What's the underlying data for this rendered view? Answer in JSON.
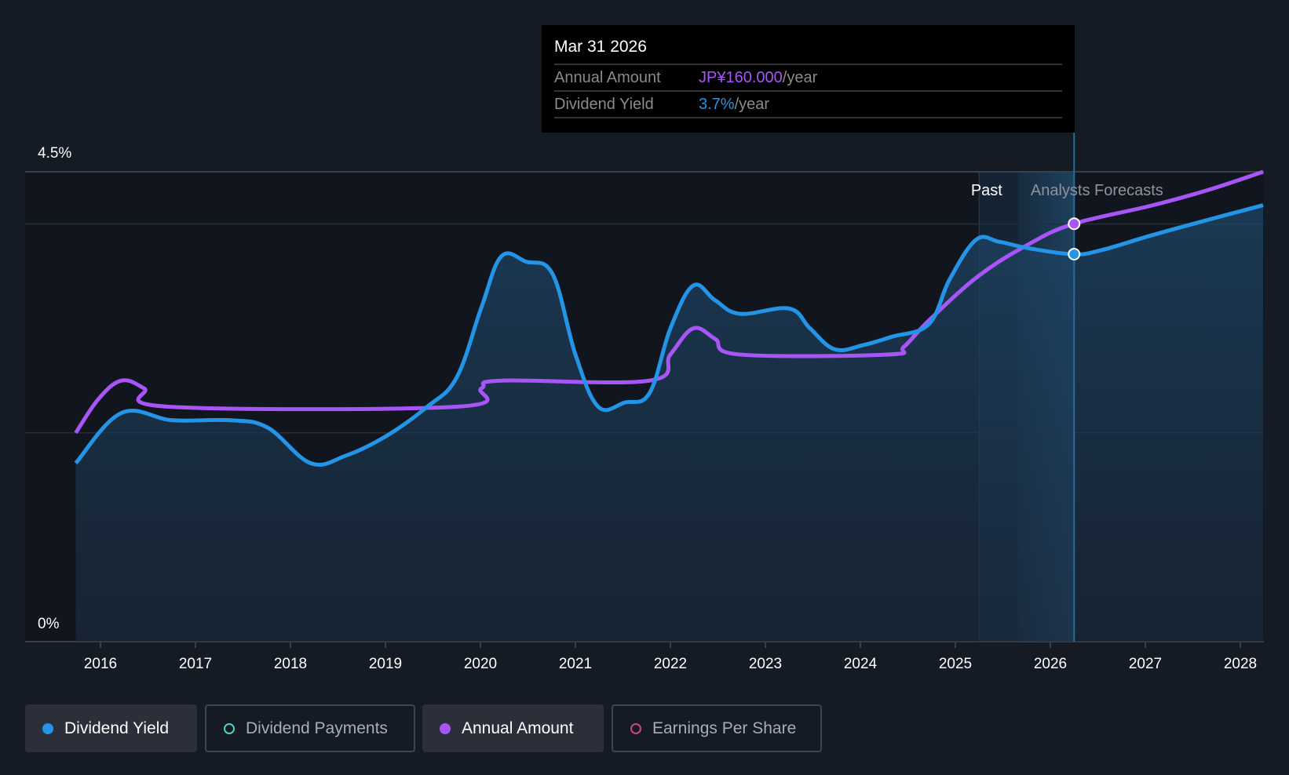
{
  "tooltip": {
    "date": "Mar 31 2026",
    "rows": [
      {
        "label": "Annual Amount",
        "value": "JP¥160.000",
        "unit": "/year",
        "color": "#a855f7"
      },
      {
        "label": "Dividend Yield",
        "value": "3.7%",
        "unit": "/year",
        "color": "#2394e6"
      }
    ]
  },
  "legend": [
    {
      "label": "Dividend Yield",
      "color": "#2394e6",
      "active": true
    },
    {
      "label": "Dividend Payments",
      "color": "#4fd1c5",
      "active": false
    },
    {
      "label": "Annual Amount",
      "color": "#a855f7",
      "active": true
    },
    {
      "label": "Earnings Per Share",
      "color": "#d0457f",
      "active": false
    }
  ],
  "chart_data": {
    "type": "line",
    "y_labels": [
      "4.5%",
      "0%"
    ],
    "ylim": [
      0,
      4.5
    ],
    "xlim": [
      2015.74,
      2028.24
    ],
    "x_ticks": [
      "2016",
      "2017",
      "2018",
      "2019",
      "2020",
      "2021",
      "2022",
      "2023",
      "2024",
      "2025",
      "2026",
      "2027",
      "2028"
    ],
    "region_labels": {
      "past": "Past",
      "forecast": "Analysts Forecasts"
    },
    "past_end": 2025.25,
    "forecast_start": 2025.66,
    "hover_x": 2026.25,
    "series": [
      {
        "name": "Dividend Yield",
        "unit": "%",
        "color": "#2394e6",
        "points": [
          [
            2015.74,
            1.71
          ],
          [
            2016.22,
            2.19
          ],
          [
            2016.76,
            2.12
          ],
          [
            2017.37,
            2.12
          ],
          [
            2017.76,
            2.05
          ],
          [
            2018.21,
            1.71
          ],
          [
            2018.58,
            1.78
          ],
          [
            2019.01,
            1.97
          ],
          [
            2019.44,
            2.25
          ],
          [
            2019.75,
            2.53
          ],
          [
            2020.01,
            3.2
          ],
          [
            2020.22,
            3.69
          ],
          [
            2020.48,
            3.64
          ],
          [
            2020.76,
            3.52
          ],
          [
            2021.0,
            2.75
          ],
          [
            2021.24,
            2.25
          ],
          [
            2021.52,
            2.29
          ],
          [
            2021.78,
            2.38
          ],
          [
            2022.0,
            3.0
          ],
          [
            2022.24,
            3.41
          ],
          [
            2022.47,
            3.27
          ],
          [
            2022.73,
            3.14
          ],
          [
            2023.25,
            3.19
          ],
          [
            2023.47,
            3.0
          ],
          [
            2023.73,
            2.8
          ],
          [
            2024.03,
            2.84
          ],
          [
            2024.33,
            2.92
          ],
          [
            2024.72,
            3.04
          ],
          [
            2024.94,
            3.47
          ],
          [
            2025.22,
            3.85
          ],
          [
            2025.46,
            3.83
          ],
          [
            2025.76,
            3.77
          ],
          [
            2026.24,
            3.71
          ],
          [
            2026.54,
            3.75
          ],
          [
            2027.06,
            3.89
          ],
          [
            2027.66,
            4.04
          ],
          [
            2028.24,
            4.18
          ]
        ]
      },
      {
        "name": "Annual Amount",
        "unit": "JP¥",
        "color": "#a855f7",
        "scale_max": 180,
        "points": [
          [
            2015.74,
            80
          ],
          [
            2015.98,
            93
          ],
          [
            2016.22,
            100
          ],
          [
            2016.46,
            97
          ],
          [
            2016.72,
            90
          ],
          [
            2019.75,
            90
          ],
          [
            2020.01,
            97
          ],
          [
            2020.22,
            100
          ],
          [
            2021.78,
            100
          ],
          [
            2022.0,
            110
          ],
          [
            2022.24,
            120
          ],
          [
            2022.47,
            116
          ],
          [
            2022.73,
            110
          ],
          [
            2024.29,
            110
          ],
          [
            2024.46,
            113
          ],
          [
            2024.72,
            123
          ],
          [
            2025.24,
            140
          ],
          [
            2025.76,
            152
          ],
          [
            2026.24,
            160
          ],
          [
            2027.06,
            167
          ],
          [
            2027.66,
            173
          ],
          [
            2028.24,
            180
          ]
        ]
      }
    ]
  }
}
